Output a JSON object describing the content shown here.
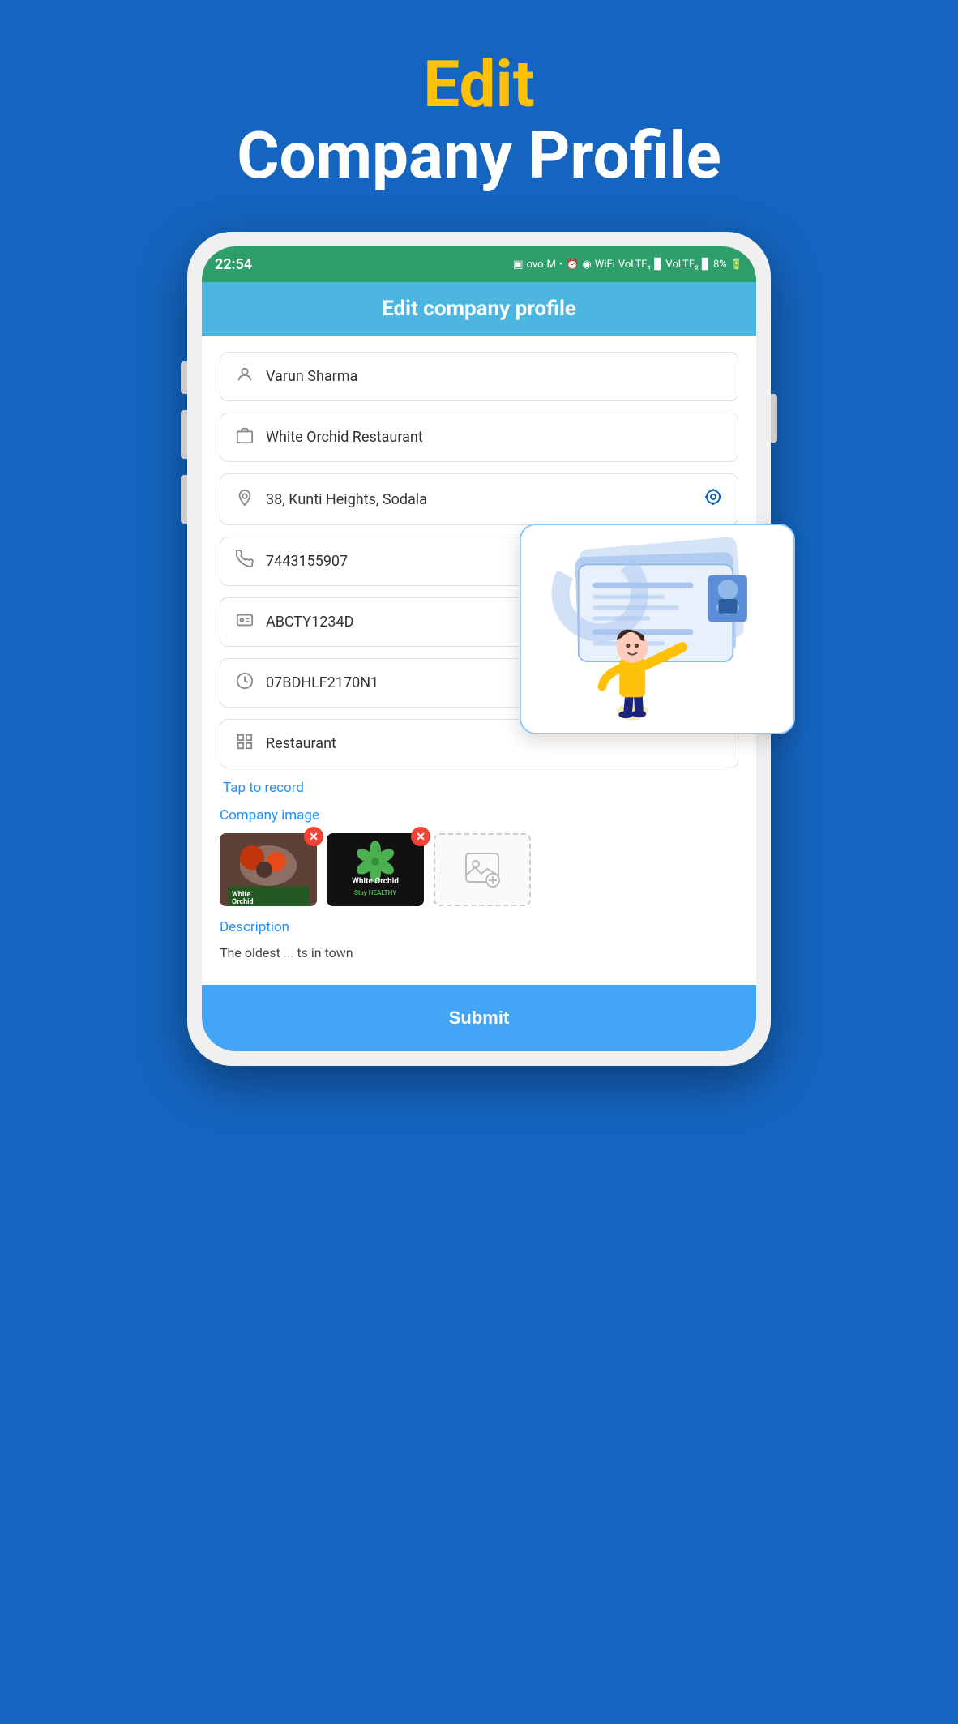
{
  "page": {
    "title_highlight": "Edit",
    "title_main": "Company Profile"
  },
  "status_bar": {
    "time": "22:54",
    "icons": "⊙ ovo M • ⏰ ⊕ ⊙ VoLTE LTE2 8%"
  },
  "header": {
    "title": "Edit company profile"
  },
  "form": {
    "fields": [
      {
        "icon": "👤",
        "value": "Varun Sharma",
        "name": "name-field"
      },
      {
        "icon": "🏢",
        "value": "White Orchid Restaurant",
        "name": "company-field"
      },
      {
        "icon": "📍",
        "value": "38, Kunti Heights, Sodala",
        "name": "address-field",
        "has_action": true
      },
      {
        "icon": "📞",
        "value": "7443155907",
        "name": "phone-field"
      },
      {
        "icon": "🪪",
        "value": "ABCTY1234D",
        "name": "pan-field"
      },
      {
        "icon": "⊙",
        "value": "07BDHLF2170N1",
        "name": "gstin-field"
      },
      {
        "icon": "🗂",
        "value": "Restaurant",
        "name": "category-field"
      }
    ],
    "tap_record_label": "Tap to record",
    "company_image_label": "Company image",
    "images": [
      {
        "type": "food",
        "label": "White\nOrchid",
        "remove": true
      },
      {
        "type": "orchid",
        "label": "White Orchid",
        "sub": "Stay HEALTHY",
        "remove": true
      },
      {
        "type": "add"
      }
    ],
    "description_label": "Description",
    "description_text": "The oldest",
    "description_suffix": "ts in town",
    "submit_label": "Submit"
  }
}
